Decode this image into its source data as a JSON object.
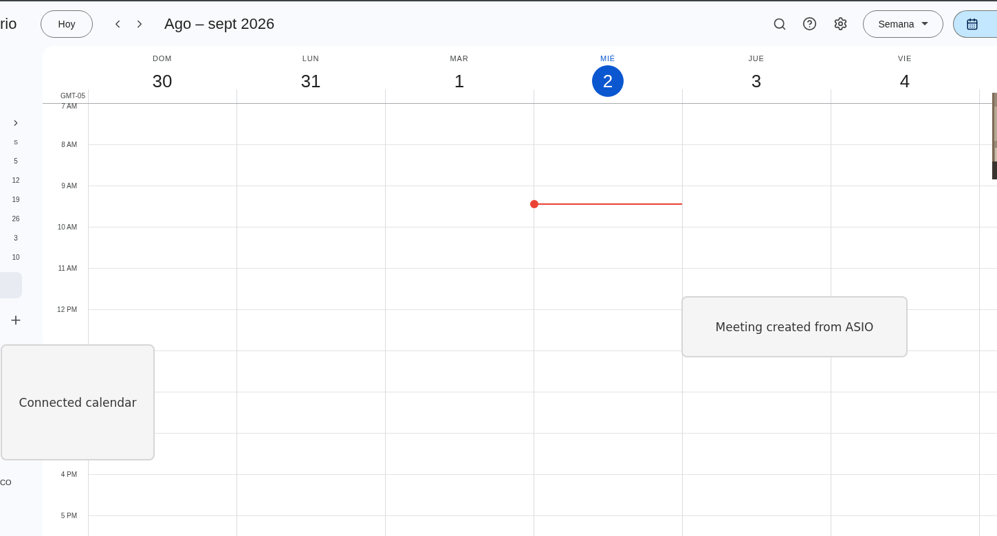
{
  "app": {
    "title_fragment": "rio"
  },
  "toolbar": {
    "today_button": "Hoy",
    "title": "Ago – sept 2026",
    "view_select": "Semana",
    "view_toggle": [
      {
        "kind": "calendar",
        "selected": true
      }
    ]
  },
  "mini_calendar": {
    "weekday": "S",
    "weeks": [
      "5",
      "12",
      "19",
      "26",
      "3",
      "10"
    ]
  },
  "sidebar": {
    "highlighted_item": {
      "selected": true
    },
    "footer_fragment": "CO"
  },
  "week": {
    "timezone": "GMT-05",
    "days": [
      {
        "weekday": "DOM",
        "day": "30",
        "today": false
      },
      {
        "weekday": "LUN",
        "day": "31",
        "today": false
      },
      {
        "weekday": "MAR",
        "day": "1",
        "today": false
      },
      {
        "weekday": "MIÉ",
        "day": "2",
        "today": true,
        "now_line": true
      },
      {
        "weekday": "JUE",
        "day": "3",
        "today": false
      },
      {
        "weekday": "VIE",
        "day": "4",
        "today": false
      }
    ],
    "hours": [
      {
        "label": "7 AM"
      },
      {
        "label": "8 AM"
      },
      {
        "label": "9 AM"
      },
      {
        "label": "10 AM"
      },
      {
        "label": "11 AM"
      },
      {
        "label": "12 PM"
      }
    ],
    "later_hours": [
      {
        "label": "4 PM"
      },
      {
        "label": "5 PM"
      }
    ]
  },
  "popups": [
    {
      "kind": "card",
      "text": "Connected calendar"
    },
    {
      "kind": "card",
      "text": "Meeting created from ASIO"
    }
  ]
}
